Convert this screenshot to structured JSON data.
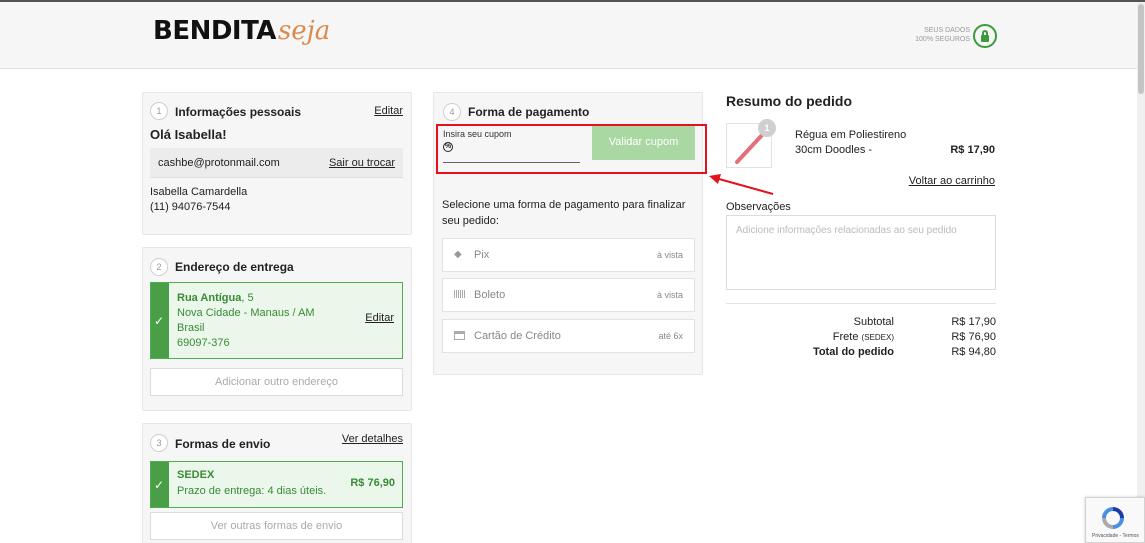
{
  "header": {
    "logo_main": "BENDITA",
    "logo_script": "seja",
    "secure_line1": "SEUS DADOS",
    "secure_line2": "100% SEGUROS"
  },
  "personal": {
    "step": "1",
    "title": "Informações pessoais",
    "edit_label": "Editar",
    "greeting": "Olá Isabella!",
    "email": "cashbe@protonmail.com",
    "logout_label": "Sair ou trocar",
    "name": "Isabella Camardella",
    "phone": "(11) 94076-7544"
  },
  "address": {
    "step": "2",
    "title": "Endereço de entrega",
    "street": "Rua Antígua",
    "number": ", 5",
    "city": "Nova Cidade - Manaus / AM",
    "country": "Brasil",
    "zip": "69097-376",
    "edit_label": "Editar",
    "add_label": "Adicionar outro endereço"
  },
  "shipping": {
    "step": "3",
    "title": "Formas de envio",
    "details_label": "Ver detalhes",
    "method": "SEDEX",
    "eta": "Prazo de entrega: 4 dias úteis.",
    "price": "R$ 76,90",
    "other_label": "Ver outras formas de envio"
  },
  "payment": {
    "step": "4",
    "title": "Forma de pagamento",
    "coupon_label": "Insira seu cupom",
    "coupon_value": "",
    "validate_label": "Validar cupom",
    "description": "Selecione uma forma de pagamento para finalizar seu pedido:",
    "options": [
      {
        "label": "Pix",
        "term": "à vista",
        "icon": "pix-icon"
      },
      {
        "label": "Boleto",
        "term": "à vista",
        "icon": "barcode-icon"
      },
      {
        "label": "Cartão de Crédito",
        "term": "até 6x",
        "icon": "credit-card-icon"
      }
    ]
  },
  "summary": {
    "title": "Resumo do pedido",
    "product": {
      "name": "Régua em Poliestireno 30cm Doodles -",
      "qty": "1",
      "price": "R$ 17,90"
    },
    "back_to_cart": "Voltar ao carrinho",
    "notes_label": "Observações",
    "notes_placeholder": "Adicione informações relacionadas ao seu pedido",
    "notes_value": "",
    "subtotal_label": "Subtotal",
    "subtotal_value": "R$ 17,90",
    "freight_label": "Frete",
    "freight_method": "(SEDEX)",
    "freight_value": "R$ 76,90",
    "total_label": "Total do pedido",
    "total_value": "R$ 94,80"
  },
  "recaptcha": {
    "text": "Privacidade - Termos"
  },
  "colors": {
    "accent_green": "#4a9e47",
    "validate_button": "#a9d8a2",
    "highlight_red": "#e5111c",
    "logo_orange": "#d98a4f"
  }
}
